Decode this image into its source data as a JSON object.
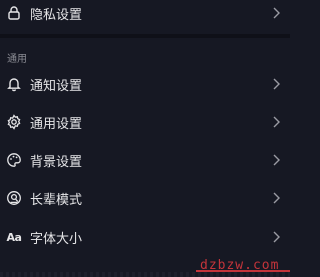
{
  "privacy_item": {
    "label": "隐私设置",
    "icon": "lock-icon"
  },
  "general_section": {
    "title": "通用",
    "items": [
      {
        "label": "通知设置",
        "icon": "bell-icon"
      },
      {
        "label": "通用设置",
        "icon": "gear-icon"
      },
      {
        "label": "背景设置",
        "icon": "palette-icon"
      },
      {
        "label": "长辈模式",
        "icon": "elder-mode-icon"
      },
      {
        "label": "字体大小",
        "icon": "font-size-icon",
        "icon_text": "Aa"
      }
    ]
  },
  "watermark": {
    "text": "dzbzw.com"
  },
  "colors": {
    "background": "#161823",
    "text": "#e6e6e8",
    "muted": "#8a8b93",
    "watermark": "#c4343a"
  }
}
